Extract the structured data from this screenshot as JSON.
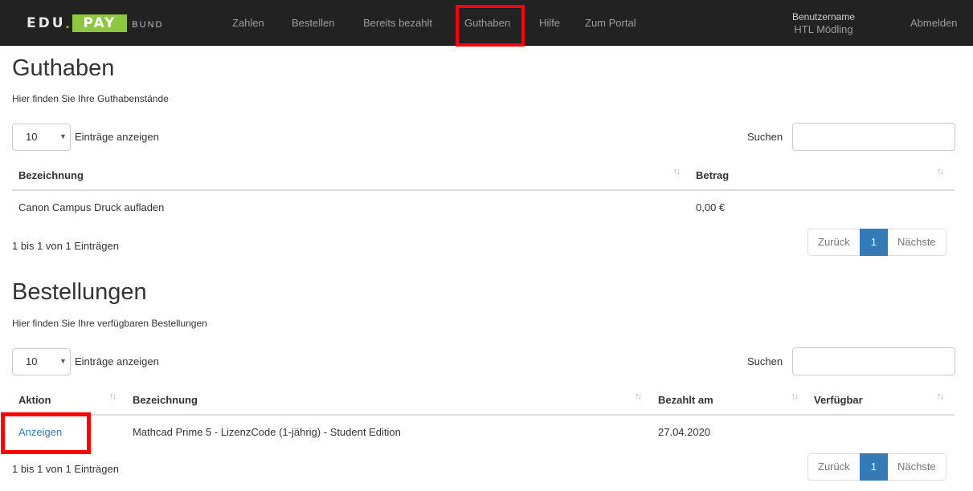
{
  "brand": {
    "edu": "EDU",
    "dot": ".",
    "pay": "PAY",
    "bund": "BUND"
  },
  "nav": {
    "items": [
      {
        "label": "Zahlen"
      },
      {
        "label": "Bestellen"
      },
      {
        "label": "Bereits bezahlt"
      },
      {
        "label": "Guthaben"
      },
      {
        "label": "Hilfe"
      },
      {
        "label": "Zum Portal"
      }
    ],
    "active": "Guthaben",
    "user_label": "Benutzername",
    "user_name": "HTL Mödling",
    "logout": "Abmelden"
  },
  "guthaben": {
    "title": "Guthaben",
    "subtitle": "Hier finden Sie Ihre Guthabenstände",
    "length_value": "10",
    "length_label": "Einträge anzeigen",
    "search_label": "Suchen",
    "search_value": "",
    "columns": [
      "Bezeichnung",
      "Betrag"
    ],
    "rows": [
      {
        "bezeichnung": "Canon Campus Druck aufladen",
        "betrag": "0,00 €"
      }
    ],
    "info": "1 bis 1 von 1 Einträgen",
    "pager": {
      "prev": "Zurück",
      "page": "1",
      "next": "Nächste"
    }
  },
  "bestellungen": {
    "title": "Bestellungen",
    "subtitle": "Hier finden Sie Ihre verfügbaren Bestellungen",
    "length_value": "10",
    "length_label": "Einträge anzeigen",
    "search_label": "Suchen",
    "search_value": "",
    "columns": [
      "Aktion",
      "Bezeichnung",
      "Bezahlt am",
      "Verfügbar"
    ],
    "rows": [
      {
        "aktion": "Anzeigen",
        "bezeichnung": "Mathcad Prime 5 - LizenzCode (1-jährig) - Student Edition",
        "bezahlt_am": "27.04.2020",
        "verfuegbar": ""
      }
    ],
    "info": "1 bis 1 von 1 Einträgen",
    "pager": {
      "prev": "Zurück",
      "page": "1",
      "next": "Nächste"
    }
  },
  "colors": {
    "navbar": "#222222",
    "brand_green": "#8dc63f",
    "link": "#337ab7",
    "highlight": "#ff0000"
  },
  "icons": {
    "sort": "sort-both-icon",
    "select_caret": "caret-down-icon"
  }
}
